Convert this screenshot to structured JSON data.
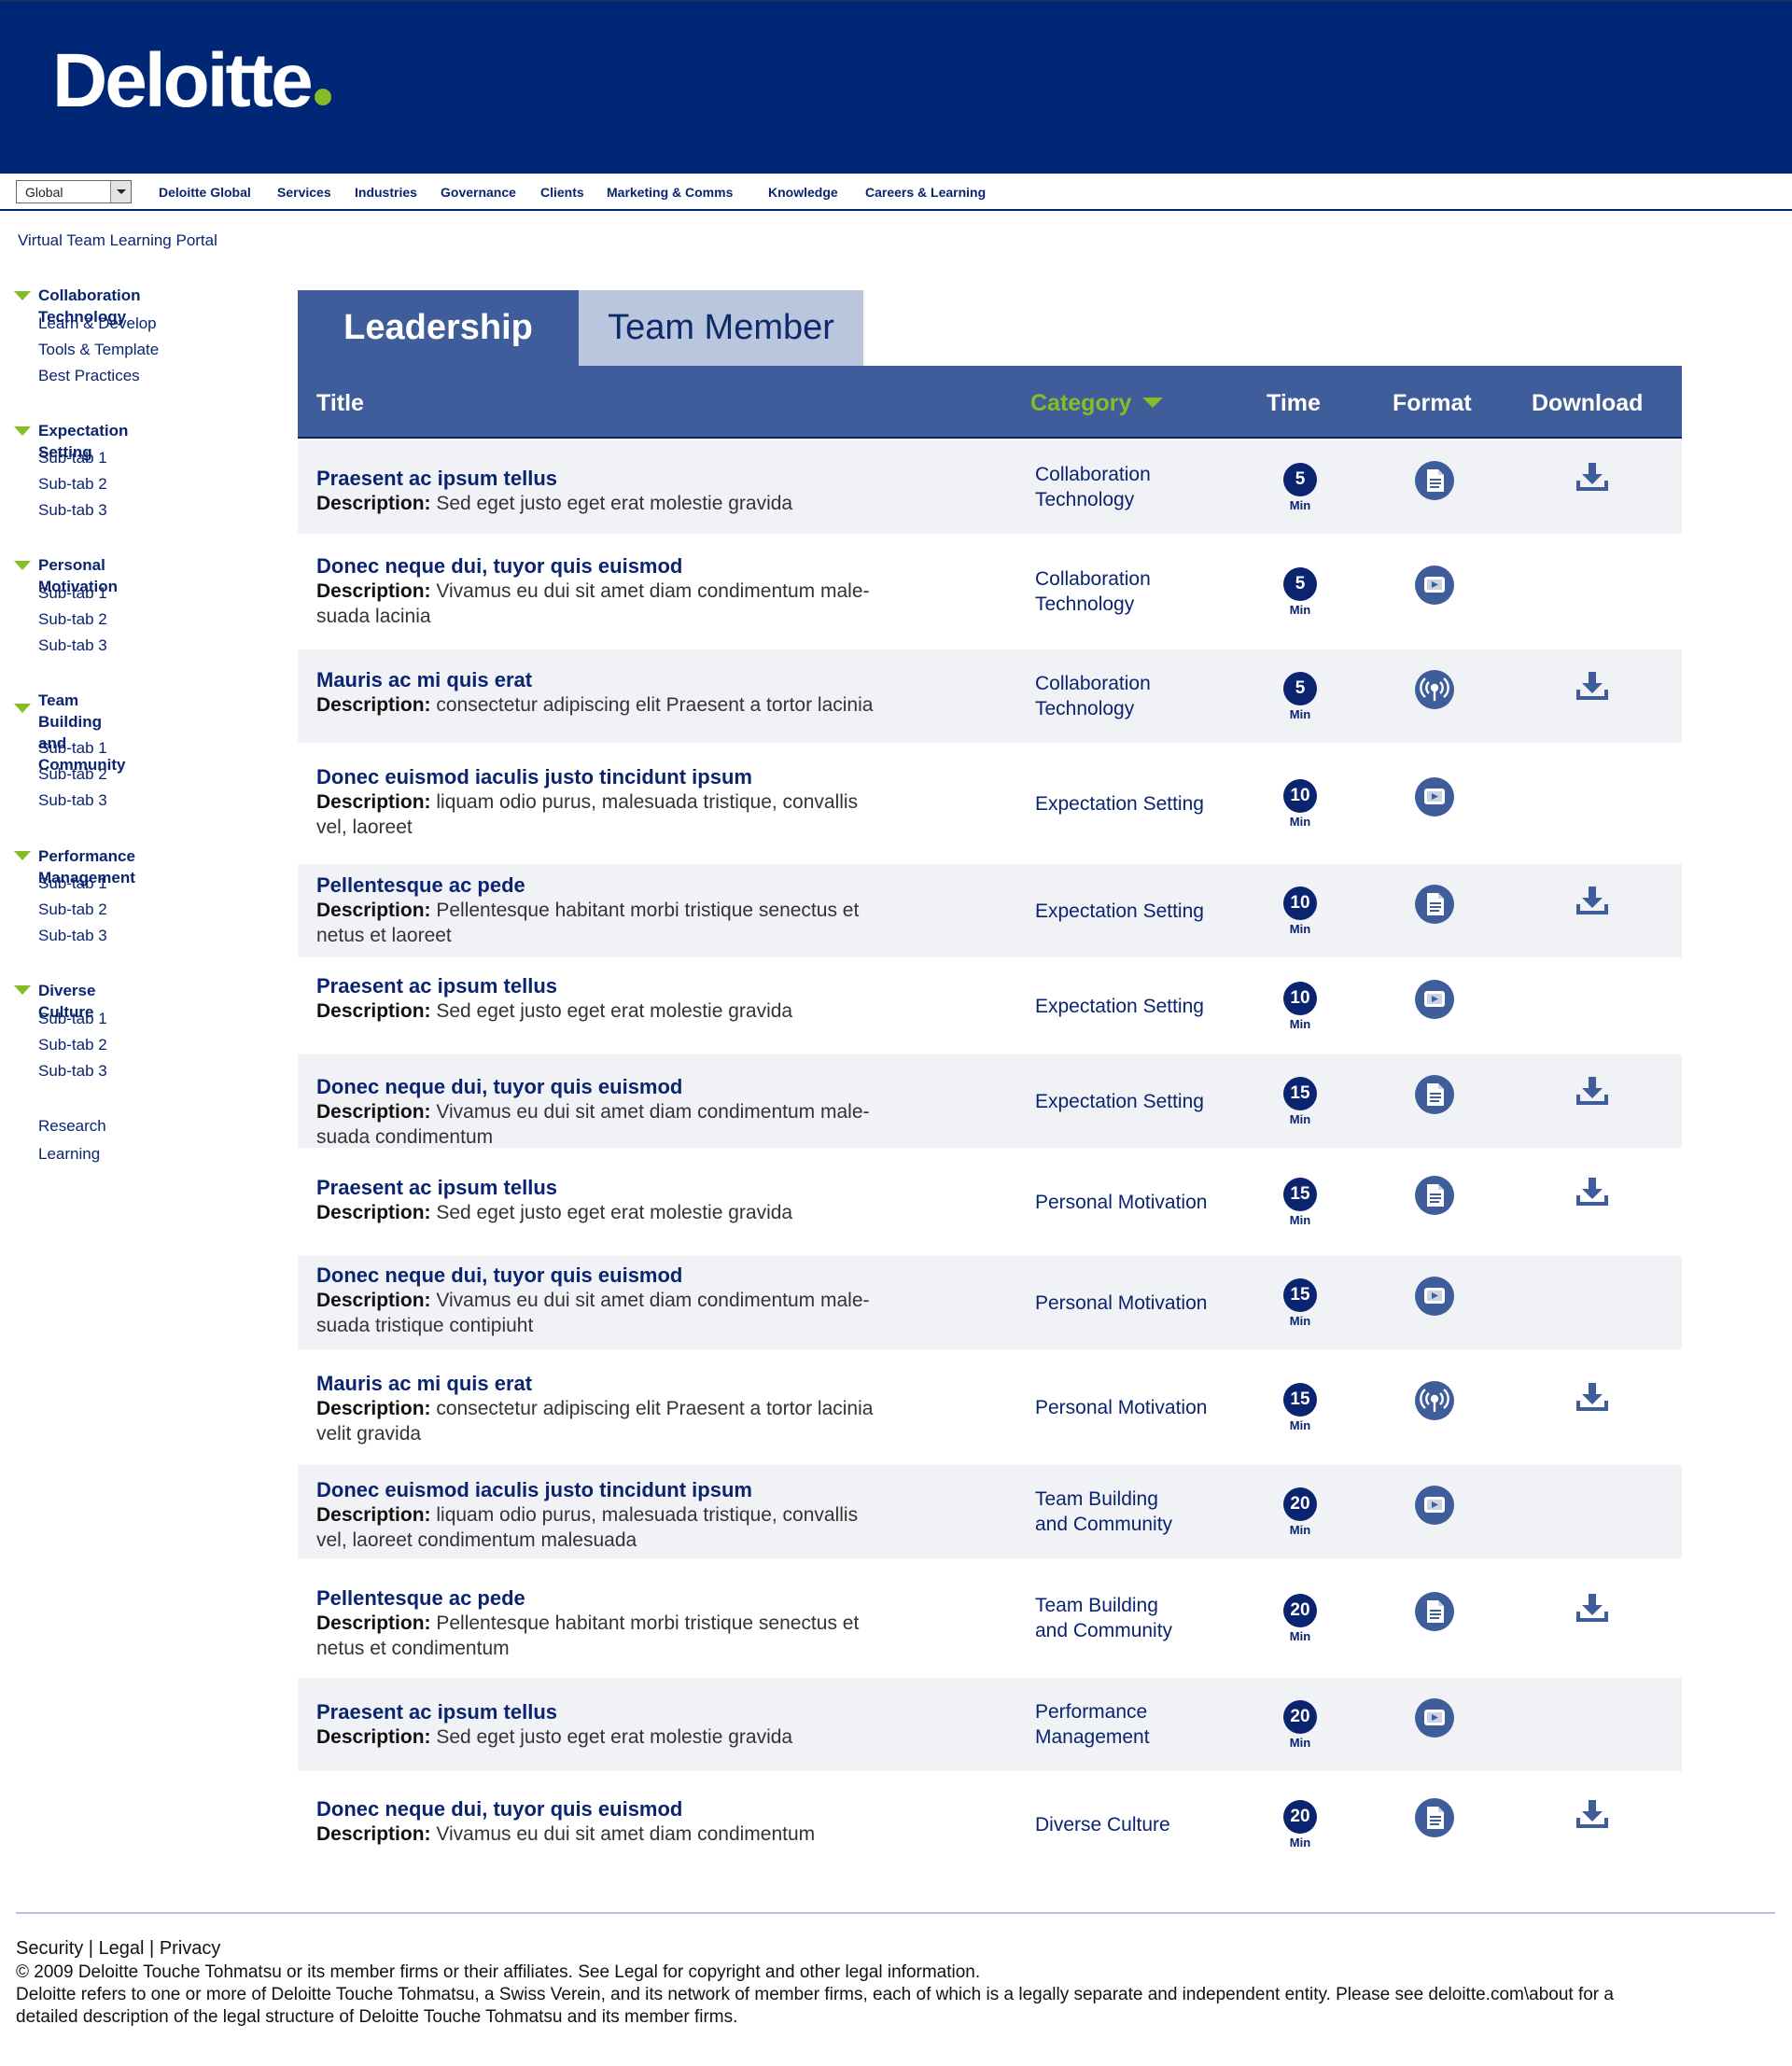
{
  "header": {
    "logo_text": "Deloitte",
    "brand_colors": {
      "navy": "#002776",
      "green": "#86bc25"
    }
  },
  "topnav": {
    "region_select": "Global",
    "links": [
      "Deloitte Global",
      "Services",
      "Industries",
      "Governance",
      "Clients",
      "Marketing & Comms",
      "Knowledge",
      "Careers & Learning"
    ]
  },
  "portal_title": "Virtual Team Learning Portal",
  "sidebar": {
    "sections": [
      {
        "title": "Collaboration Technology",
        "items": [
          "Learn & Develop",
          "Tools & Template",
          "Best Practices"
        ]
      },
      {
        "title": "Expectation Setting",
        "items": [
          "Sub-tab 1",
          "Sub-tab 2",
          "Sub-tab 3"
        ]
      },
      {
        "title": "Personal Motivation",
        "items": [
          "Sub-tab 1",
          "Sub-tab 2",
          "Sub-tab 3"
        ]
      },
      {
        "title_line1": "Team Building",
        "title_line2": "and Community",
        "items": [
          "Sub-tab 1",
          "Sub-tab 2",
          "Sub-tab 3"
        ]
      },
      {
        "title": "Performance Management",
        "items": [
          "Sub-tab 1",
          "Sub-tab 2",
          "Sub-tab 3"
        ]
      },
      {
        "title": "Diverse Culture",
        "items": [
          "Sub-tab 1",
          "Sub-tab 2",
          "Sub-tab 3"
        ]
      }
    ],
    "extra_links": [
      "Research",
      "Learning"
    ]
  },
  "tabs": [
    {
      "label": "Leadership",
      "active": true
    },
    {
      "label": "Team Member",
      "active": false
    }
  ],
  "table": {
    "columns": {
      "title": "Title",
      "category": "Category",
      "time": "Time",
      "format": "Format",
      "download": "Download"
    },
    "desc_label": "Description:",
    "min_label": "Min",
    "rows": [
      {
        "title": "Praesent ac ipsum tellus",
        "desc": [
          "Sed eget justo eget erat molestie gravida"
        ],
        "cat": [
          "Collaboration",
          "Technology"
        ],
        "time": "5",
        "format": "document",
        "download": true
      },
      {
        "title": "Donec neque dui, tuyor quis euismod",
        "desc": [
          "Vivamus eu dui sit amet diam condimentum male-",
          "suada lacinia"
        ],
        "cat": [
          "Collaboration",
          "Technology"
        ],
        "time": "5",
        "format": "video",
        "download": false
      },
      {
        "title": "Mauris ac mi quis erat",
        "desc": [
          "consectetur adipiscing elit Praesent a tortor lacinia"
        ],
        "cat": [
          "Collaboration",
          "Technology"
        ],
        "time": "5",
        "format": "podcast",
        "download": true
      },
      {
        "title": "Donec euismod iaculis justo tincidunt ipsum",
        "desc": [
          "liquam odio purus, malesuada tristique, convallis",
          "vel, laoreet"
        ],
        "cat": [
          "Expectation Setting"
        ],
        "time": "10",
        "format": "video",
        "download": false
      },
      {
        "title": "Pellentesque ac pede",
        "desc": [
          "Pellentesque habitant morbi tristique senectus et",
          "netus et laoreet"
        ],
        "cat": [
          "Expectation Setting"
        ],
        "time": "10",
        "format": "document",
        "download": true
      },
      {
        "title": "Praesent ac ipsum tellus",
        "desc": [
          "Sed eget justo eget erat molestie gravida"
        ],
        "cat": [
          "Expectation Setting"
        ],
        "time": "10",
        "format": "video",
        "download": false
      },
      {
        "title": "Donec neque dui, tuyor quis euismod",
        "desc": [
          "Vivamus eu dui sit amet diam condimentum male-",
          "suada condimentum"
        ],
        "cat": [
          "Expectation Setting"
        ],
        "time": "15",
        "format": "document",
        "download": true
      },
      {
        "title": "Praesent ac ipsum tellus",
        "desc": [
          "Sed eget justo eget erat molestie gravida"
        ],
        "cat": [
          "Personal Motivation"
        ],
        "time": "15",
        "format": "document",
        "download": true
      },
      {
        "title": "Donec neque dui, tuyor quis euismod",
        "desc": [
          "Vivamus eu dui sit amet diam condimentum male-",
          "suada tristique contipiuht"
        ],
        "cat": [
          "Personal Motivation"
        ],
        "time": "15",
        "format": "video",
        "download": false
      },
      {
        "title": "Mauris ac mi quis erat",
        "desc": [
          "consectetur adipiscing elit Praesent a tortor lacinia",
          "velit gravida"
        ],
        "cat": [
          "Personal Motivation"
        ],
        "time": "15",
        "format": "podcast",
        "download": true
      },
      {
        "title": "Donec euismod iaculis justo tincidunt ipsum",
        "desc": [
          "liquam odio purus, malesuada tristique, convallis",
          "vel, laoreet condimentum malesuada"
        ],
        "cat": [
          "Team Building",
          "and Community"
        ],
        "time": "20",
        "format": "video",
        "download": false
      },
      {
        "title": "Pellentesque ac pede",
        "desc": [
          "Pellentesque habitant morbi tristique senectus et",
          "netus et condimentum"
        ],
        "cat": [
          "Team Building",
          "and Community"
        ],
        "time": "20",
        "format": "document",
        "download": true
      },
      {
        "title": "Praesent ac ipsum tellus",
        "desc": [
          "Sed eget justo eget erat molestie gravida"
        ],
        "cat": [
          "Performance",
          "Management"
        ],
        "time": "20",
        "format": "video",
        "download": false
      },
      {
        "title": "Donec neque dui, tuyor quis euismod",
        "desc": [
          "Vivamus eu dui sit amet diam condimentum"
        ],
        "cat": [
          "Diverse Culture"
        ],
        "time": "20",
        "format": "document",
        "download": true
      }
    ]
  },
  "footer": {
    "links": [
      "Security",
      "Legal",
      "Privacy"
    ],
    "copyright": "© 2009 Deloitte Touche Tohmatsu or its member firms or their affiliates. See Legal for copyright and other legal information.",
    "legal_line1": "Deloitte refers to one or more of Deloitte Touche Tohmatsu, a Swiss Verein, and its network of member firms, each of which is a legally separate and independent entity. Please see deloitte.com\\about for a",
    "legal_line2": "detailed description of the legal structure of Deloitte Touche Tohmatsu and its member firms."
  }
}
